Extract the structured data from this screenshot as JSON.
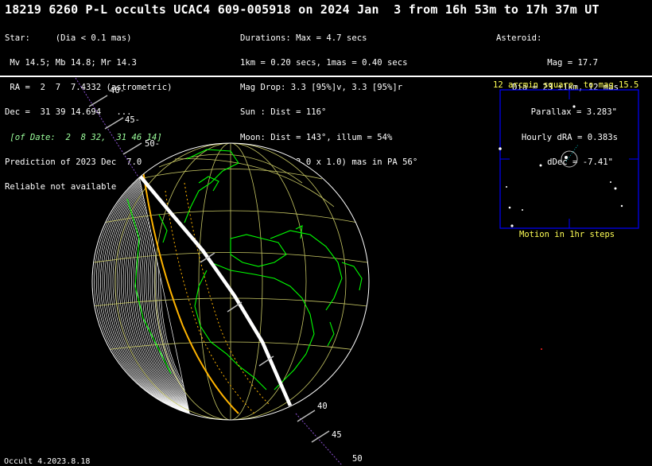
{
  "title": "18219 6260 P-L occults UCAC4 609-005918 on 2024 Jan  3 from 16h 53m to 17h 37m UT",
  "star": {
    "lines": [
      "Star:     (Dia < 0.1 mas)",
      " Mv 14.5; Mb 14.8; Mr 14.3",
      " RA =  2  7  7.4332 (astrometric)",
      "Dec =  31 39 14.694   ...",
      " [of Date:  2  8 32,  31 46 14]",
      "Prediction of 2023 Dec  7.0",
      "Reliable not available"
    ]
  },
  "event": {
    "lines": [
      "Durations: Max = 4.7 secs",
      "1km = 0.20 secs, 1mas = 0.40 secs",
      "Mag Drop: 3.3 [95%]v, 3.3 [95%]r",
      "Sun : Dist = 116°",
      "Moon: Dist = 143°, illum = 54%",
      "1σ Err: ±(13.0 x 1.0) mas in PA 56°"
    ]
  },
  "asteroid": {
    "lines": [
      "Asteroid:",
      "Mag = 17.7",
      "Dia = 23 ±1km, 12 mas",
      "Parallax = 3.283\"",
      "Hourly dRA = 0.383s",
      "dDec = -7.41\""
    ]
  },
  "path_labels": {
    "upper": [
      "40-",
      "45-",
      "50-"
    ],
    "lower": [
      "40",
      "45",
      "50"
    ]
  },
  "starchart": {
    "title": "12 arcmin square, to mag 15.5",
    "caption": "Motion in 1hr steps"
  },
  "footer": "Occult 4.2023.8.18",
  "colors": {
    "background": "#000000",
    "text": "#ffffff",
    "land": "#00ff00",
    "grid": "#c8c864",
    "path_center": "#ffffff",
    "path_limit": "#ffb400",
    "chart_frame": "#0000ff",
    "chart_text": "#ffff55"
  }
}
